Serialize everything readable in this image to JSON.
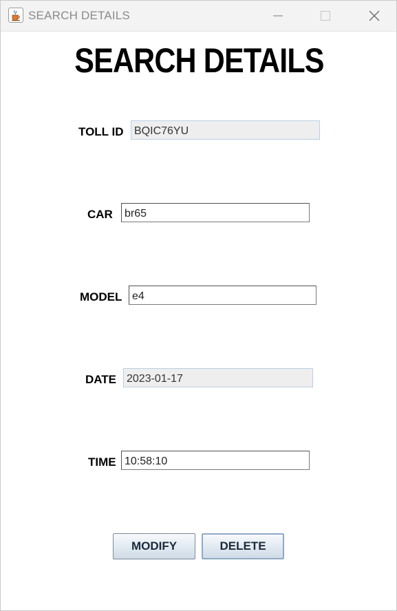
{
  "window": {
    "title": "SEARCH DETAILS",
    "icon": "java-cup-icon",
    "controls": [
      "minimize-icon",
      "maximize-icon",
      "close-icon"
    ]
  },
  "heading": "SEARCH DETAILS",
  "form": {
    "toll_id": {
      "label": "TOLL ID",
      "value": "BQIC76YU",
      "editable": false
    },
    "car": {
      "label": "CAR",
      "value": "br65",
      "editable": true
    },
    "model": {
      "label": "MODEL",
      "value": "e4",
      "editable": true
    },
    "date": {
      "label": "DATE",
      "value": "2023-01-17",
      "editable": false
    },
    "time": {
      "label": "TIME",
      "value": "10:58:10",
      "editable": true
    }
  },
  "buttons": {
    "modify": "MODIFY",
    "delete": "DELETE"
  },
  "colors": {
    "titlebar_bg": "#f3f3f3",
    "readonly_field_bg": "#eeeeee",
    "button_gradient_top": "#f7f9fb",
    "button_gradient_bottom": "#cfdbe7"
  }
}
